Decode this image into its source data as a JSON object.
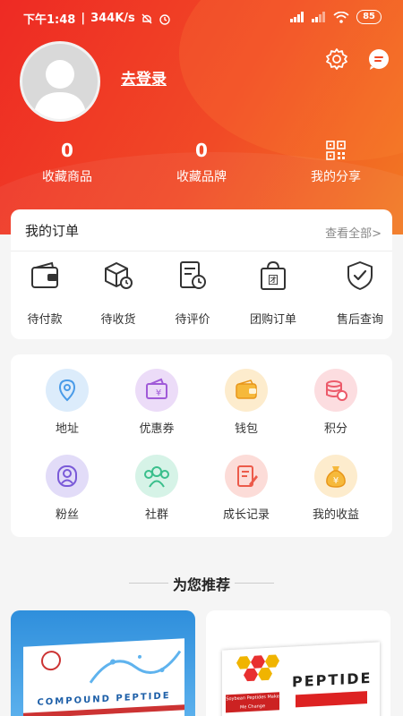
{
  "status_bar": {
    "time": "下午1:48",
    "speed": "344K/s",
    "battery": "85"
  },
  "profile": {
    "login_label": "去登录"
  },
  "stats": [
    {
      "value": "0",
      "label": "收藏商品"
    },
    {
      "value": "0",
      "label": "收藏品牌"
    },
    {
      "label": "我的分享"
    }
  ],
  "orders": {
    "title": "我的订单",
    "view_all": "查看全部>",
    "items": [
      {
        "label": "待付款",
        "icon": "wallet-icon"
      },
      {
        "label": "待收货",
        "icon": "package-icon"
      },
      {
        "label": "待评价",
        "icon": "review-icon"
      },
      {
        "label": "团购订单",
        "icon": "group-bag-icon"
      },
      {
        "label": "售后查询",
        "icon": "shield-check-icon"
      }
    ]
  },
  "tools": [
    {
      "label": "地址",
      "icon": "location-icon",
      "color": "#4a9be8",
      "bg": "#dcecfb"
    },
    {
      "label": "优惠券",
      "icon": "coupon-icon",
      "color": "#a05ad8",
      "bg": "#ecdcf8"
    },
    {
      "label": "钱包",
      "icon": "wallet-icon",
      "color": "#f0a32a",
      "bg": "#fdeccd"
    },
    {
      "label": "积分",
      "icon": "coins-icon",
      "color": "#ec5a6a",
      "bg": "#fcdde0"
    },
    {
      "label": "粉丝",
      "icon": "fans-icon",
      "color": "#7a5ad8",
      "bg": "#e2dcf8"
    },
    {
      "label": "社群",
      "icon": "community-icon",
      "color": "#3abf8c",
      "bg": "#d6f3e7"
    },
    {
      "label": "成长记录",
      "icon": "growth-record-icon",
      "color": "#ec5a4a",
      "bg": "#fcdcd8"
    },
    {
      "label": "我的收益",
      "icon": "money-bag-icon",
      "color": "#f0a32a",
      "bg": "#fdeccd"
    }
  ],
  "recommend": {
    "title": "为您推荐"
  },
  "products": [
    {
      "box_text": "COMPOUND PEPTIDE"
    },
    {
      "box_text": "PEPTIDE",
      "sub_text": "Soybean Peptides Make Me Change"
    }
  ],
  "colors": {
    "brand_red": "#ee2a24",
    "brand_orange": "#f27a22"
  }
}
